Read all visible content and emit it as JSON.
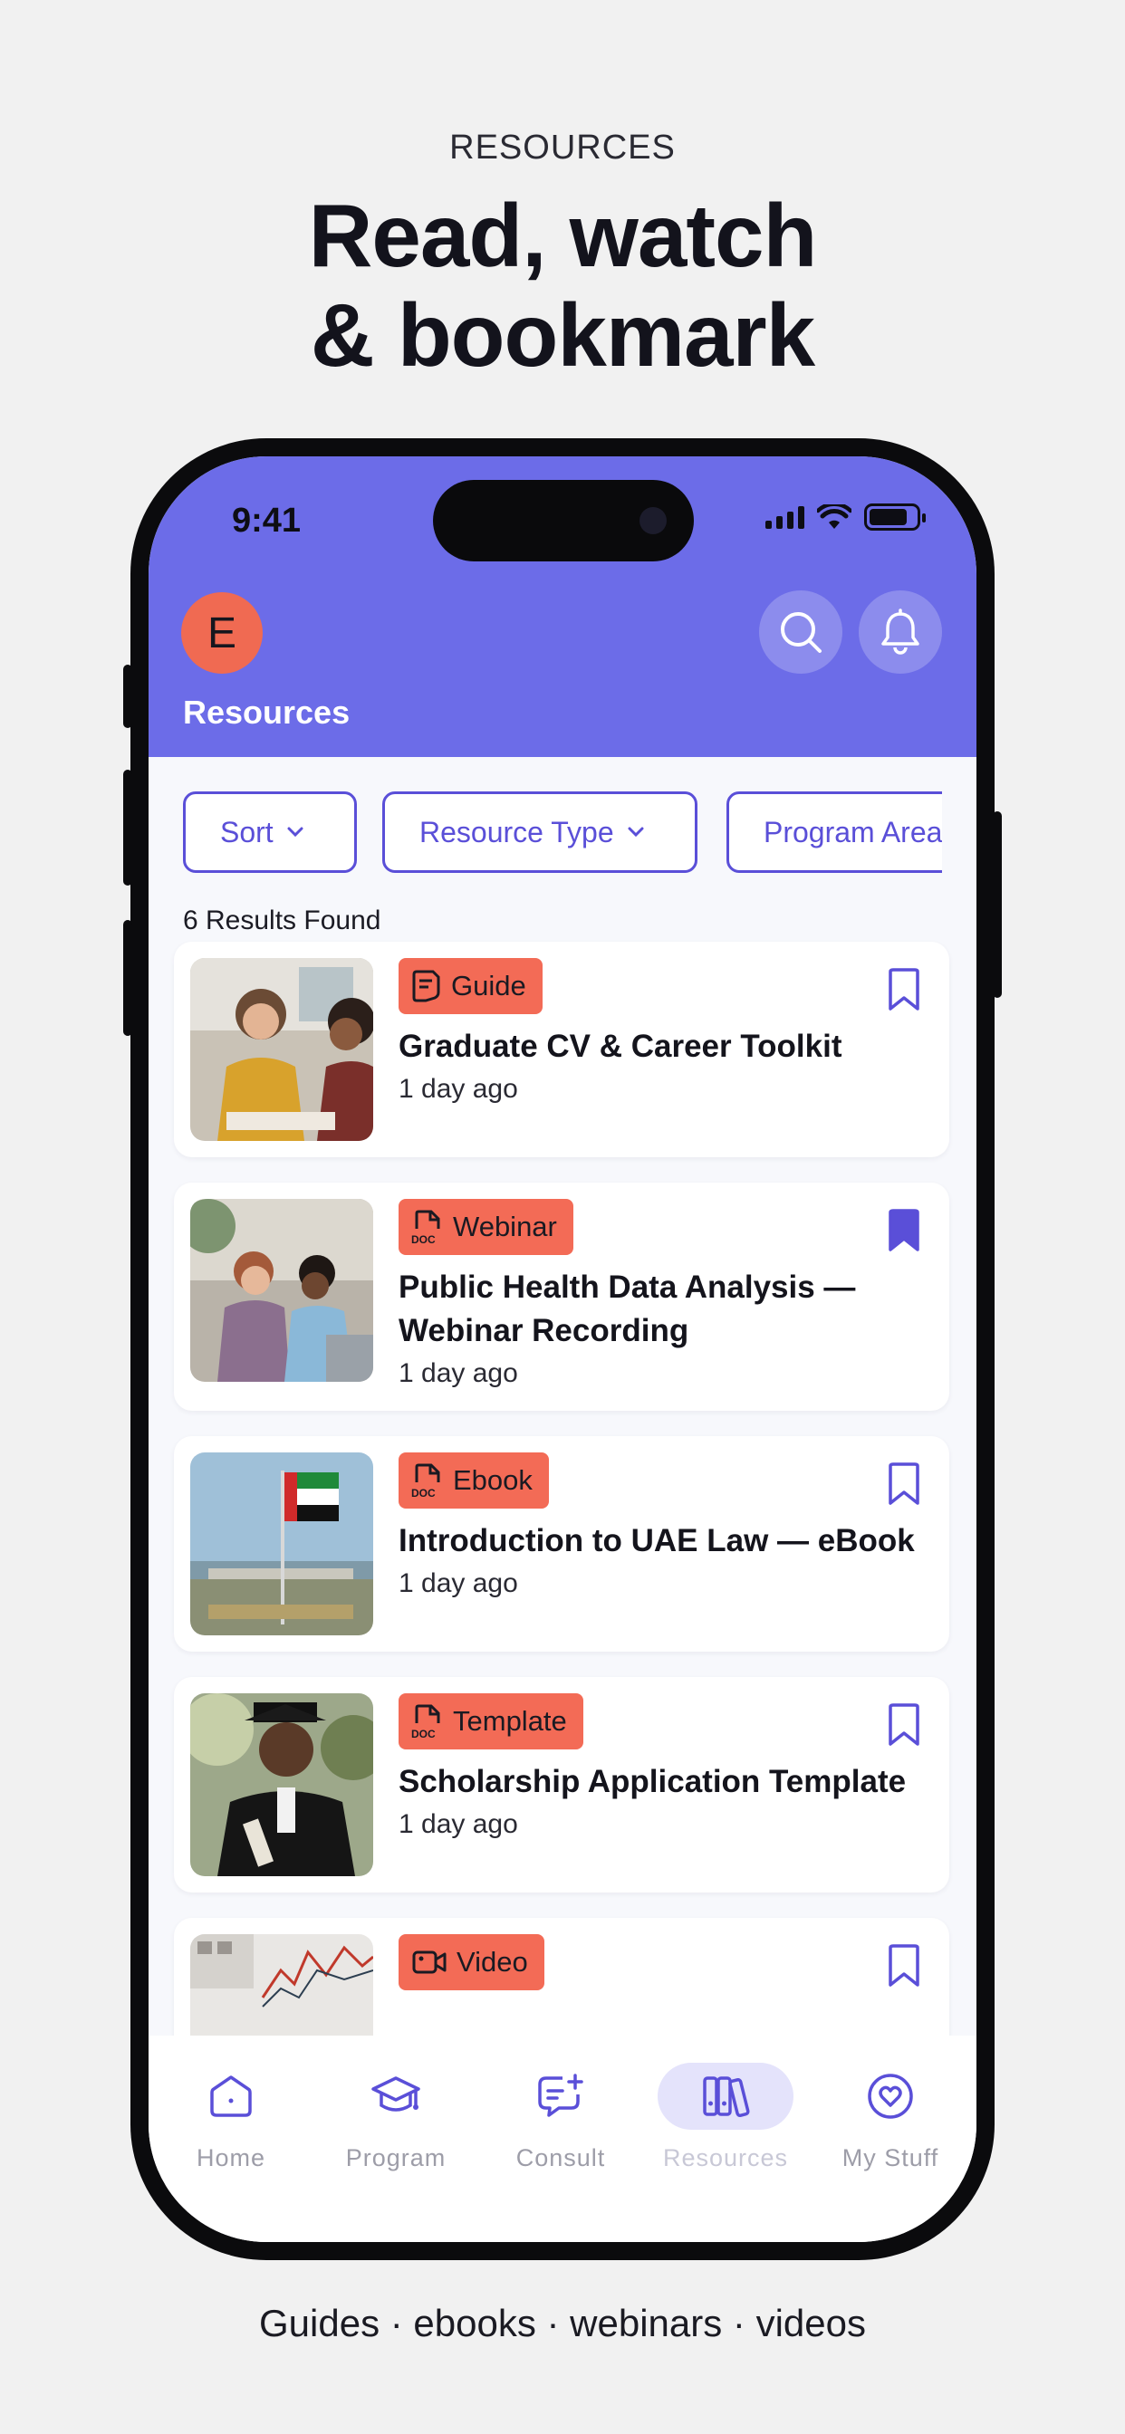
{
  "marketing": {
    "eyebrow": "RESOURCES",
    "headline_line1": "Read, watch",
    "headline_line2": "& bookmark",
    "footer": "Guides · ebooks · webinars · videos"
  },
  "status_bar": {
    "time": "9:41"
  },
  "header": {
    "avatar_initial": "E",
    "title": "Resources",
    "search_icon": "search-icon",
    "notification_icon": "bell-icon",
    "color": "#6c6ce8"
  },
  "filters": [
    {
      "label": "Sort"
    },
    {
      "label": "Resource Type"
    },
    {
      "label": "Program Area"
    }
  ],
  "results_text": "6 Results Found",
  "resources": [
    {
      "tag": "Guide",
      "tag_icon": "guide-icon",
      "title": "Graduate CV & Career Toolkit",
      "time": "1 day ago",
      "bookmarked": false
    },
    {
      "tag": "Webinar",
      "tag_icon": "doc-icon",
      "title": "Public Health Data Analysis — Webinar Recording",
      "time": "1 day ago",
      "bookmarked": true
    },
    {
      "tag": "Ebook",
      "tag_icon": "doc-icon",
      "title": "Introduction to UAE Law — eBook",
      "time": "1 day ago",
      "bookmarked": false
    },
    {
      "tag": "Template",
      "tag_icon": "doc-icon",
      "title": "Scholarship Application Template",
      "time": "1 day ago",
      "bookmarked": false
    },
    {
      "tag": "Video",
      "tag_icon": "video-icon",
      "title": "",
      "time": "",
      "bookmarked": false
    }
  ],
  "tabbar": {
    "items": [
      {
        "label": "Home",
        "icon": "home-icon"
      },
      {
        "label": "Program",
        "icon": "graduation-cap-icon"
      },
      {
        "label": "Consult",
        "icon": "chat-plus-icon"
      },
      {
        "label": "Resources",
        "icon": "books-icon",
        "active": true
      },
      {
        "label": "My Stuff",
        "icon": "heart-circle-icon"
      }
    ]
  },
  "colors": {
    "accent": "#5a4fd8",
    "tag": "#f36b56",
    "avatar": "#f06a52"
  }
}
